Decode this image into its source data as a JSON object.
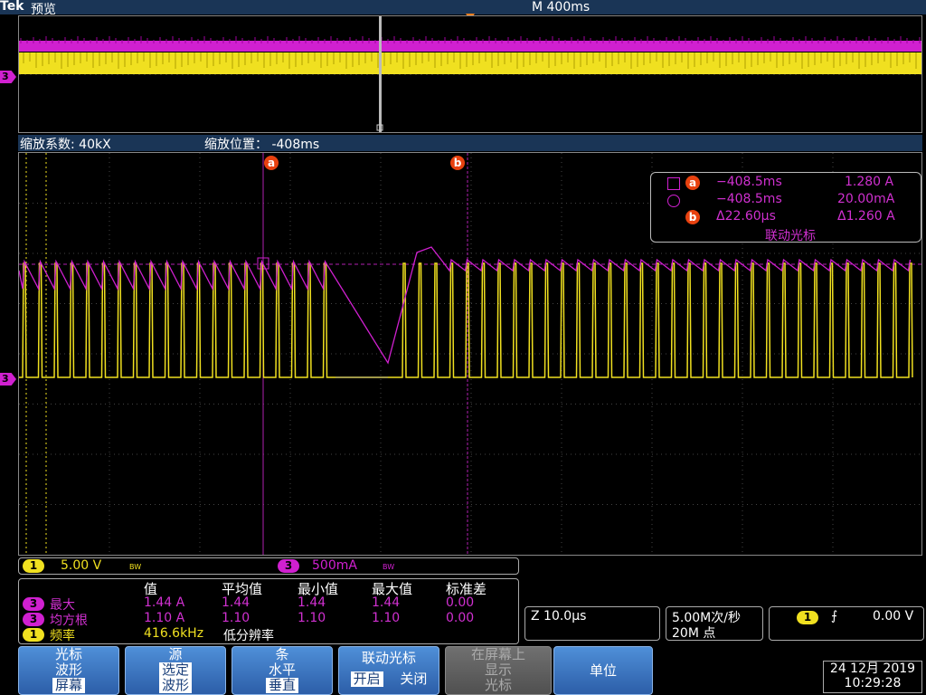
{
  "header": {
    "brand": "Tek",
    "mode": "预览",
    "timebase": "M 400ms"
  },
  "zoom": {
    "factor": "缩放系数: 40kX",
    "position": "缩放位置： -408ms"
  },
  "channel_markers": {
    "ch3": "3"
  },
  "cursors": {
    "a": "a",
    "b": "b"
  },
  "cursor_readout": {
    "row1": {
      "label": "a",
      "time": "−408.5ms",
      "value": "1.280 A"
    },
    "row2": {
      "time": "−408.5ms",
      "value": "20.00mA"
    },
    "row3": {
      "label": "b",
      "time": "Δ22.60μs",
      "value": "Δ1.260 A"
    },
    "footer": "联动光标"
  },
  "channel_bar": {
    "ch1": {
      "num": "1",
      "scale": "5.00 V",
      "bw": "BW"
    },
    "ch3": {
      "num": "3",
      "scale": "500mA",
      "bw": "BW"
    }
  },
  "measurements": {
    "headers": [
      "值",
      "平均值",
      "最小值",
      "最大值",
      "标准差"
    ],
    "rows": [
      {
        "ch": "3",
        "name": "最大",
        "value": "1.44 A",
        "mean": "1.44",
        "min": "1.44",
        "max": "1.44",
        "std": "0.00"
      },
      {
        "ch": "3",
        "name": "均方根",
        "value": "1.10 A",
        "mean": "1.10",
        "min": "1.10",
        "max": "1.10",
        "std": "0.00"
      },
      {
        "ch": "1",
        "name": "频率",
        "value": "416.6kHz",
        "note": "低分辨率"
      }
    ]
  },
  "status": {
    "zoom_scale": "Z 10.0μs",
    "sample_rate": "5.00M次/秒",
    "record_length": "20M 点",
    "trigger_ch": "1",
    "trigger_slope": "⨍",
    "trigger_level": "0.00 V"
  },
  "buttons": {
    "b1": {
      "line1": "光标",
      "line2": "波形",
      "line3": "屏幕"
    },
    "b2": {
      "line1": "源",
      "line2": "选定",
      "line3": "波形"
    },
    "b3": {
      "line1": "条",
      "line2": "水平",
      "line3": "垂直"
    },
    "b4": {
      "line1": "联动光标",
      "on": "开启",
      "off": "关闭"
    },
    "b5": {
      "line1": "在屏幕上",
      "line2": "显示",
      "line3": "光标"
    },
    "b6": {
      "line1": "单位"
    }
  },
  "datetime": {
    "date": "24 12月 2019",
    "time": "10:29:28"
  },
  "colors": {
    "ch1": "#f0e020",
    "ch3": "#d020d0",
    "cursor_label": "#e8410f",
    "menu_blue": "#2c5ea8"
  }
}
